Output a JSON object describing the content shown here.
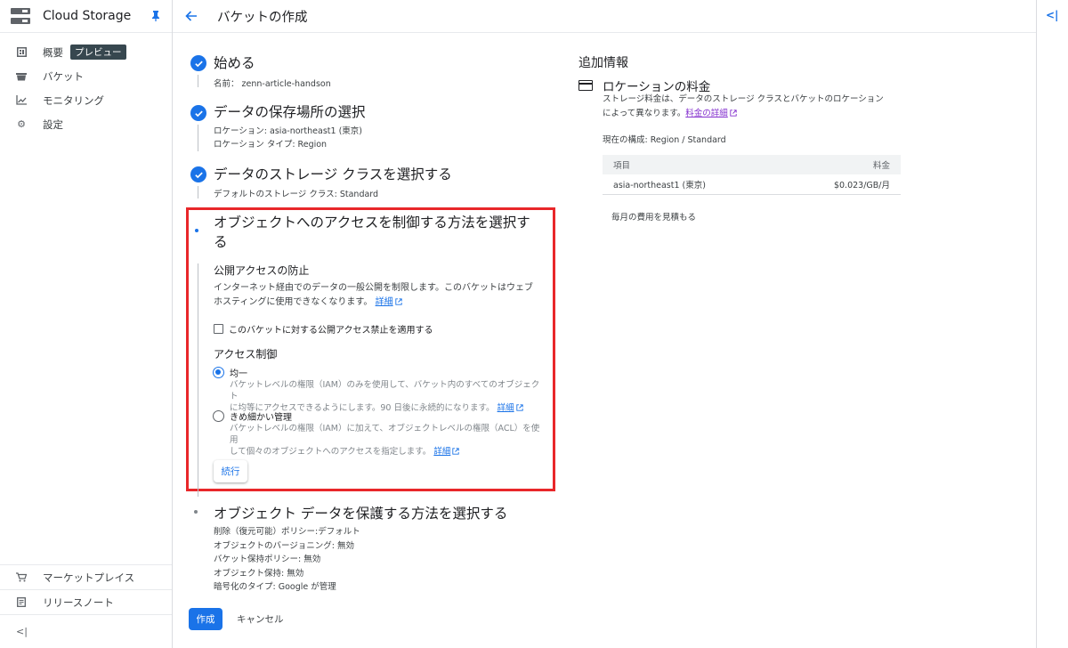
{
  "sidebar": {
    "product_title": "Cloud Storage",
    "items": [
      {
        "label": "概要",
        "badge": "プレビュー"
      },
      {
        "label": "バケット"
      },
      {
        "label": "モニタリング"
      },
      {
        "label": "設定"
      }
    ],
    "bottom_items": [
      {
        "label": "マーケットプレイス"
      },
      {
        "label": "リリースノート"
      }
    ],
    "collapse_label": "<|"
  },
  "header": {
    "title": "バケットの作成"
  },
  "steps": {
    "step1": {
      "title": "始める",
      "detail": "名前： zenn-article-handson"
    },
    "step2": {
      "title": "データの保存場所の選択",
      "detail1": "ロケーション: asia-northeast1 (東京)",
      "detail2": "ロケーション タイプ: Region"
    },
    "step3": {
      "title": "データのストレージ クラスを選択する",
      "detail": "デフォルトのストレージ クラス: Standard"
    },
    "step4": {
      "title_line1": "オブジェクトへのアクセスを制御する方法を選択す",
      "title_line2": "る",
      "public_access": {
        "title": "公開アクセスの防止",
        "desc_line1": "インターネット経由でのデータの一般公開を制限します。このバケットはウェブ",
        "desc_line2": "ホスティングに使用できなくなります。",
        "link": "詳細",
        "checkbox_label": "このバケットに対する公開アクセス禁止を適用する",
        "checkbox_checked": false
      },
      "access_control": {
        "title": "アクセス制御",
        "options": [
          {
            "label": "均一",
            "selected": true,
            "desc_line1": "バケットレベルの権限（IAM）のみを使用して、バケット内のすべてのオブジェクト",
            "desc_line2": "に均等にアクセスできるようにします。90 日後に永続的になります。",
            "link": "詳細"
          },
          {
            "label": "きめ細かい管理",
            "selected": false,
            "desc_line1": "バケットレベルの権限（IAM）に加えて、オブジェクトレベルの権限（ACL）を使用",
            "desc_line2": "して個々のオブジェクトへのアクセスを指定します。",
            "link": "詳細"
          }
        ]
      },
      "continue_label": "続行"
    },
    "step5": {
      "title": "オブジェクト データを保護する方法を選択する",
      "details": [
        "削除（復元可能）ポリシー:デフォルト",
        "オブジェクトのバージョニング: 無効",
        "バケット保持ポリシー: 無効",
        "オブジェクト保持: 無効",
        "暗号化のタイプ: Google が管理"
      ]
    }
  },
  "actions": {
    "create_label": "作成",
    "cancel_label": "キャンセル"
  },
  "info": {
    "title": "追加情報",
    "location_price_title": "ロケーションの料金",
    "desc_line1": "ストレージ料金は、データのストレージ クラスとバケットのロケーション",
    "desc_line2": "によって異なります。",
    "desc_link": "料金の詳細",
    "current_config": "現在の構成: Region / Standard",
    "table": {
      "headers": [
        "項目",
        "料金"
      ],
      "rows": [
        [
          "asia-northeast1 (東京)",
          "$0.023/GB/月"
        ]
      ]
    },
    "estimate_label": "毎月の費用を見積もる"
  },
  "colors": {
    "accent": "#1a73e8",
    "highlight": "#e8272a"
  }
}
